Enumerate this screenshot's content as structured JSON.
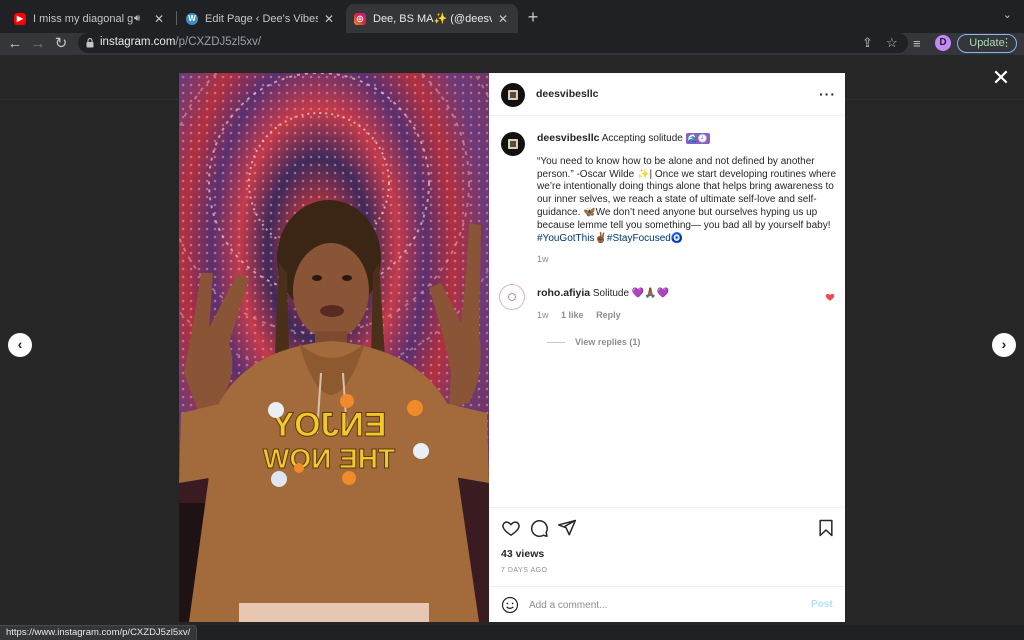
{
  "browser": {
    "tabs": [
      {
        "title": "I miss my diagonal grilled c",
        "favicon": "youtube-icon",
        "color": "#ff0000",
        "active": false
      },
      {
        "title": "Edit Page ‹ Dee's Vibes — Wor",
        "favicon": "wordpress-icon",
        "color": "#3c8ec6",
        "active": false
      },
      {
        "title": "Dee, BS MA✨ (@deesvibesllc",
        "favicon": "instagram-icon",
        "color": "#d6249f",
        "active": true
      }
    ],
    "new_tab_label": "+",
    "url_host": "instagram.com",
    "url_path": "/p/CXZDJ5zl5xv/",
    "profile_initial": "D",
    "update_label": "Update",
    "status_url": "https://www.instagram.com/p/CXZDJ5zl5xv/"
  },
  "post": {
    "username": "deesvibesllc",
    "caption": {
      "username": "deesvibesllc",
      "headline": "Accepting solitude",
      "headline_emoji": "🌊🕗",
      "body_1": "“You need to know how to be alone and not defined by another person.” -Oscar Wilde ✨| Once we start developing routines where we’re intentionally doing things alone that helps bring awareness to our inner selves, we reach a state of ultimate self-love and self-guidance. 🦋We don’t need anyone but ourselves hyping us up because lemme tell you something— you bad all by yourself baby!",
      "hashtag_1": "#YouGotThis",
      "hashtag_emoji": "✌🏾",
      "hashtag_2": "#StayFocused",
      "end_emoji": "🧿",
      "time": "1w"
    },
    "comment": {
      "username": "roho.afiyia",
      "text": "Solitude 💜🙏🏾💜",
      "time": "1w",
      "likes": "1 like",
      "reply_label": "Reply",
      "view_replies": "View replies (1)"
    },
    "views": "43 views",
    "date": "7 DAYS AGO",
    "add_comment_placeholder": "Add a comment...",
    "post_button": "Post",
    "media_shirt_text_1": "ENJOY",
    "media_shirt_text_2": "THE NOW"
  },
  "colors": {
    "accent_link": "#00376b",
    "heart": "#ed4956",
    "post_disabled": "#b2dffc"
  }
}
